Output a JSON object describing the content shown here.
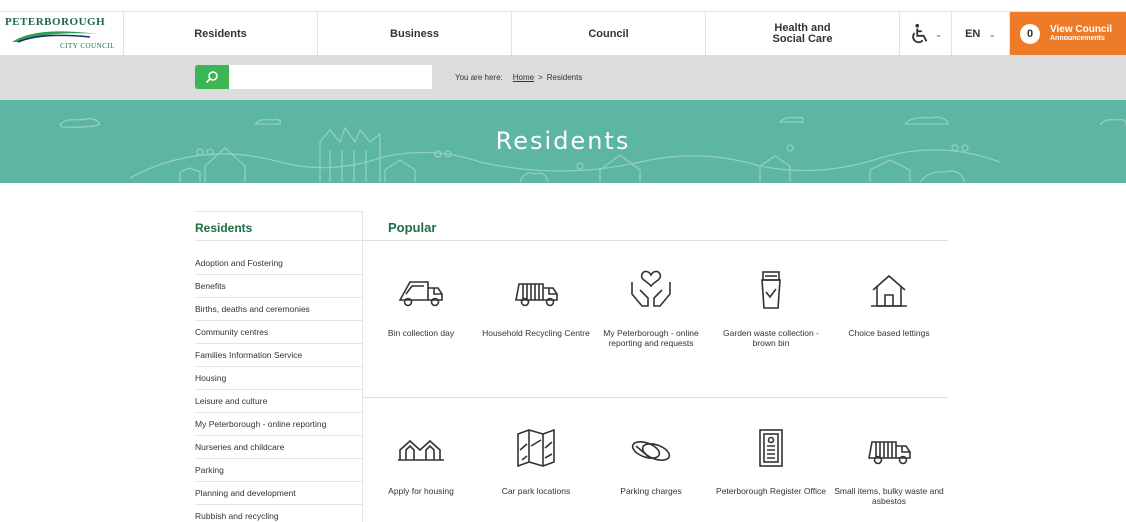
{
  "header": {
    "logo_line1": "PETERBOROUGH",
    "logo_line2": "CITY COUNCIL",
    "nav": [
      "Residents",
      "Business",
      "Council",
      "Health and Social Care"
    ],
    "language": "EN",
    "announcements_count": "0",
    "announcements_line1": "View Council",
    "announcements_line2": "Announcements",
    "icons": {
      "accessibility": "wheelchair-icon",
      "chevron": "chevron-down-icon"
    }
  },
  "search": {
    "placeholder": "",
    "value": ""
  },
  "breadcrumb": {
    "prefix": "You are here:",
    "home": "Home",
    "sep": ">",
    "current": "Residents"
  },
  "hero": {
    "title": "Residents"
  },
  "sidebar": {
    "title": "Residents",
    "items": [
      "Adoption and Fostering",
      "Benefits",
      "Births, deaths and ceremonies",
      "Community centres",
      "Families Information Service",
      "Housing",
      "Leisure and culture",
      "My Peterborough - online reporting",
      "Nurseries and childcare",
      "Parking",
      "Planning and development",
      "Rubbish and recycling"
    ]
  },
  "popular": {
    "title": "Popular",
    "tiles": [
      {
        "label": "Bin collection day",
        "icon": "bin-lorry-icon"
      },
      {
        "label": "Household Recycling Centre",
        "icon": "recycling-lorry-icon"
      },
      {
        "label": "My Peterborough - online reporting and requests",
        "icon": "hands-heart-icon"
      },
      {
        "label": "Garden waste collection - brown bin",
        "icon": "garden-bin-icon"
      },
      {
        "label": "Choice based lettings",
        "icon": "house-icon"
      },
      {
        "label": "Apply for housing",
        "icon": "houses-icon"
      },
      {
        "label": "Car park locations",
        "icon": "map-icon"
      },
      {
        "label": "Parking charges",
        "icon": "coins-icon"
      },
      {
        "label": "Peterborough Register Office",
        "icon": "certificate-icon"
      },
      {
        "label": "Small items, bulky waste and asbestos",
        "icon": "bulky-waste-lorry-icon"
      }
    ]
  },
  "colors": {
    "brand_green": "#1e6e45",
    "hero_teal": "#5db5a4",
    "search_green": "#3cb554",
    "announce_orange": "#ee7b27"
  }
}
